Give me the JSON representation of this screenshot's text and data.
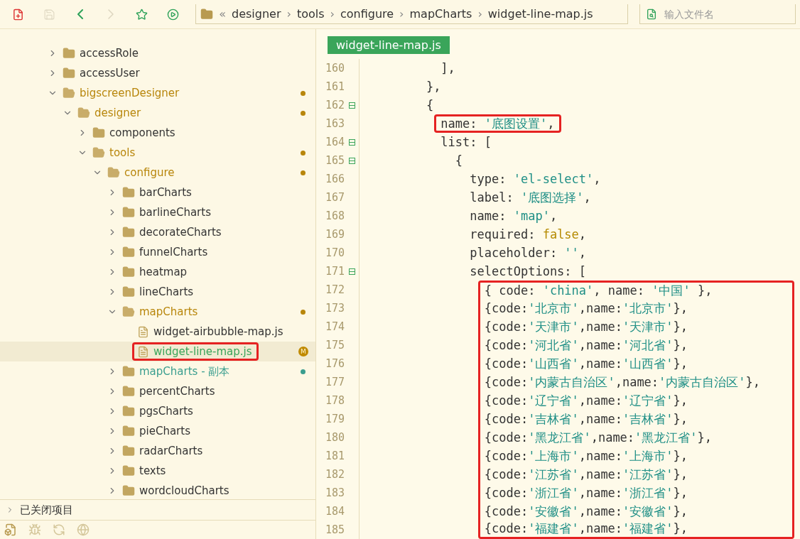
{
  "toolbar": {
    "buttons": [
      {
        "kind": "new-file",
        "disabled": false
      },
      {
        "kind": "save",
        "disabled": true
      },
      {
        "kind": "back",
        "disabled": false
      },
      {
        "kind": "forward",
        "disabled": true
      },
      {
        "kind": "favorite",
        "disabled": false
      },
      {
        "kind": "run",
        "disabled": false
      }
    ],
    "breadcrumb": {
      "overflow": "«",
      "separator": "›",
      "segments": [
        "designer",
        "tools",
        "configure",
        "mapCharts",
        "widget-line-map.js"
      ]
    },
    "search": {
      "placeholder": "输入文件名"
    }
  },
  "tree": [
    {
      "name": "accessRole",
      "kind": "folder",
      "expanded": false
    },
    {
      "name": "accessUser",
      "kind": "folder",
      "expanded": false
    },
    {
      "name": "bigscreenDesigner",
      "kind": "folder",
      "expanded": true,
      "color": "#b8860b",
      "children": [
        {
          "name": "designer",
          "kind": "folder",
          "expanded": true,
          "color": "#b8860b",
          "children": [
            {
              "name": "components",
              "kind": "folder",
              "expanded": false
            },
            {
              "name": "tools",
              "kind": "folder",
              "expanded": true,
              "color": "#b8860b",
              "children": [
                {
                  "name": "configure",
                  "kind": "folder",
                  "expanded": true,
                  "color": "#b8860b",
                  "children": [
                    {
                      "name": "barCharts",
                      "kind": "folder",
                      "expanded": false
                    },
                    {
                      "name": "barlineCharts",
                      "kind": "folder",
                      "expanded": false
                    },
                    {
                      "name": "decorateCharts",
                      "kind": "folder",
                      "expanded": false
                    },
                    {
                      "name": "funnelCharts",
                      "kind": "folder",
                      "expanded": false
                    },
                    {
                      "name": "heatmap",
                      "kind": "folder",
                      "expanded": false
                    },
                    {
                      "name": "lineCharts",
                      "kind": "folder",
                      "expanded": false
                    },
                    {
                      "name": "mapCharts",
                      "kind": "folder",
                      "expanded": true,
                      "color": "#b8860b",
                      "children": [
                        {
                          "name": "widget-airbubble-map.js",
                          "kind": "file",
                          "selected": false
                        },
                        {
                          "name": "widget-line-map.js",
                          "kind": "file",
                          "selected": true,
                          "boxed": true,
                          "badge": "M"
                        }
                      ]
                    },
                    {
                      "name": "mapCharts - 副本",
                      "kind": "folder",
                      "expanded": false,
                      "color": "#3a9e8f"
                    },
                    {
                      "name": "percentCharts",
                      "kind": "folder",
                      "expanded": false
                    },
                    {
                      "name": "pgsCharts",
                      "kind": "folder",
                      "expanded": false
                    },
                    {
                      "name": "pieCharts",
                      "kind": "folder",
                      "expanded": false
                    },
                    {
                      "name": "radarCharts",
                      "kind": "folder",
                      "expanded": false
                    },
                    {
                      "name": "texts",
                      "kind": "folder",
                      "expanded": false
                    },
                    {
                      "name": "wordcloudCharts",
                      "kind": "folder",
                      "expanded": false
                    }
                  ]
                }
              ]
            }
          ]
        }
      ]
    }
  ],
  "closed_projects": {
    "label": "已关闭项目",
    "expanded": false
  },
  "bottom_tabs": [
    {
      "kind": "files",
      "selected": true
    },
    {
      "kind": "debug",
      "selected": false
    },
    {
      "kind": "git",
      "selected": false
    },
    {
      "kind": "web",
      "selected": false
    }
  ],
  "editor": {
    "tab": "widget-line-map.js",
    "lines": [
      {
        "number": "160",
        "tokens": [
          {
            "kind": "plain",
            "text": "          ],"
          }
        ]
      },
      {
        "number": "161",
        "tokens": [
          {
            "kind": "plain",
            "text": "        },"
          }
        ]
      },
      {
        "number": "162",
        "foldable": true,
        "tokens": [
          {
            "kind": "plain",
            "text": "        {"
          }
        ]
      },
      {
        "number": "163",
        "boxed": true,
        "tokens": [
          {
            "kind": "plain",
            "text": "          name: "
          },
          {
            "kind": "string",
            "text": "'底图设置'"
          },
          {
            "kind": "plain",
            "text": ","
          }
        ]
      },
      {
        "number": "164",
        "foldable": true,
        "tokens": [
          {
            "kind": "plain",
            "text": "          list: ["
          }
        ]
      },
      {
        "number": "165",
        "foldable": true,
        "tokens": [
          {
            "kind": "plain",
            "text": "            {"
          }
        ]
      },
      {
        "number": "166",
        "tokens": [
          {
            "kind": "plain",
            "text": "              type: "
          },
          {
            "kind": "string",
            "text": "'el-select'"
          },
          {
            "kind": "plain",
            "text": ","
          }
        ]
      },
      {
        "number": "167",
        "tokens": [
          {
            "kind": "plain",
            "text": "              label: "
          },
          {
            "kind": "string",
            "text": "'底图选择'"
          },
          {
            "kind": "plain",
            "text": ","
          }
        ]
      },
      {
        "number": "168",
        "tokens": [
          {
            "kind": "plain",
            "text": "              name: "
          },
          {
            "kind": "string",
            "text": "'map'"
          },
          {
            "kind": "plain",
            "text": ","
          }
        ]
      },
      {
        "number": "169",
        "tokens": [
          {
            "kind": "plain",
            "text": "              required: "
          },
          {
            "kind": "keyword",
            "text": "false"
          },
          {
            "kind": "plain",
            "text": ","
          }
        ]
      },
      {
        "number": "170",
        "tokens": [
          {
            "kind": "plain",
            "text": "              placeholder: "
          },
          {
            "kind": "string",
            "text": "''"
          },
          {
            "kind": "plain",
            "text": ","
          }
        ]
      },
      {
        "number": "171",
        "foldable": true,
        "tokens": [
          {
            "kind": "plain",
            "text": "              selectOptions: ["
          }
        ]
      },
      {
        "number": "172",
        "boxed": true,
        "tokens": [
          {
            "kind": "plain",
            "text": "                { code: "
          },
          {
            "kind": "string",
            "text": "'china'"
          },
          {
            "kind": "plain",
            "text": ", name: "
          },
          {
            "kind": "string",
            "text": "'中国'"
          },
          {
            "kind": "plain",
            "text": " },"
          }
        ]
      },
      {
        "number": "173",
        "boxed": true,
        "tokens": [
          {
            "kind": "plain",
            "text": "                {code:"
          },
          {
            "kind": "string",
            "text": "'北京市'"
          },
          {
            "kind": "plain",
            "text": ",name:"
          },
          {
            "kind": "string",
            "text": "'北京市'"
          },
          {
            "kind": "plain",
            "text": "},"
          }
        ]
      },
      {
        "number": "174",
        "boxed": true,
        "tokens": [
          {
            "kind": "plain",
            "text": "                {code:"
          },
          {
            "kind": "string",
            "text": "'天津市'"
          },
          {
            "kind": "plain",
            "text": ",name:"
          },
          {
            "kind": "string",
            "text": "'天津市'"
          },
          {
            "kind": "plain",
            "text": "},"
          }
        ]
      },
      {
        "number": "175",
        "boxed": true,
        "tokens": [
          {
            "kind": "plain",
            "text": "                {code:"
          },
          {
            "kind": "string",
            "text": "'河北省'"
          },
          {
            "kind": "plain",
            "text": ",name:"
          },
          {
            "kind": "string",
            "text": "'河北省'"
          },
          {
            "kind": "plain",
            "text": "},"
          }
        ]
      },
      {
        "number": "176",
        "boxed": true,
        "tokens": [
          {
            "kind": "plain",
            "text": "                {code:"
          },
          {
            "kind": "string",
            "text": "'山西省'"
          },
          {
            "kind": "plain",
            "text": ",name:"
          },
          {
            "kind": "string",
            "text": "'山西省'"
          },
          {
            "kind": "plain",
            "text": "},"
          }
        ]
      },
      {
        "number": "177",
        "boxed": true,
        "tokens": [
          {
            "kind": "plain",
            "text": "                {code:"
          },
          {
            "kind": "string",
            "text": "'内蒙古自治区'"
          },
          {
            "kind": "plain",
            "text": ",name:"
          },
          {
            "kind": "string",
            "text": "'内蒙古自治区'"
          },
          {
            "kind": "plain",
            "text": "},"
          }
        ]
      },
      {
        "number": "178",
        "boxed": true,
        "tokens": [
          {
            "kind": "plain",
            "text": "                {code:"
          },
          {
            "kind": "string",
            "text": "'辽宁省'"
          },
          {
            "kind": "plain",
            "text": ",name:"
          },
          {
            "kind": "string",
            "text": "'辽宁省'"
          },
          {
            "kind": "plain",
            "text": "},"
          }
        ]
      },
      {
        "number": "179",
        "boxed": true,
        "tokens": [
          {
            "kind": "plain",
            "text": "                {code:"
          },
          {
            "kind": "string",
            "text": "'吉林省'"
          },
          {
            "kind": "plain",
            "text": ",name:"
          },
          {
            "kind": "string",
            "text": "'吉林省'"
          },
          {
            "kind": "plain",
            "text": "},"
          }
        ]
      },
      {
        "number": "180",
        "boxed": true,
        "tokens": [
          {
            "kind": "plain",
            "text": "                {code:"
          },
          {
            "kind": "string",
            "text": "'黑龙江省'"
          },
          {
            "kind": "plain",
            "text": ",name:"
          },
          {
            "kind": "string",
            "text": "'黑龙江省'"
          },
          {
            "kind": "plain",
            "text": "},"
          }
        ]
      },
      {
        "number": "181",
        "boxed": true,
        "tokens": [
          {
            "kind": "plain",
            "text": "                {code:"
          },
          {
            "kind": "string",
            "text": "'上海市'"
          },
          {
            "kind": "plain",
            "text": ",name:"
          },
          {
            "kind": "string",
            "text": "'上海市'"
          },
          {
            "kind": "plain",
            "text": "},"
          }
        ]
      },
      {
        "number": "182",
        "boxed": true,
        "tokens": [
          {
            "kind": "plain",
            "text": "                {code:"
          },
          {
            "kind": "string",
            "text": "'江苏省'"
          },
          {
            "kind": "plain",
            "text": ",name:"
          },
          {
            "kind": "string",
            "text": "'江苏省'"
          },
          {
            "kind": "plain",
            "text": "},"
          }
        ]
      },
      {
        "number": "183",
        "boxed": true,
        "tokens": [
          {
            "kind": "plain",
            "text": "                {code:"
          },
          {
            "kind": "string",
            "text": "'浙江省'"
          },
          {
            "kind": "plain",
            "text": ",name:"
          },
          {
            "kind": "string",
            "text": "'浙江省'"
          },
          {
            "kind": "plain",
            "text": "},"
          }
        ]
      },
      {
        "number": "184",
        "boxed": true,
        "tokens": [
          {
            "kind": "plain",
            "text": "                {code:"
          },
          {
            "kind": "string",
            "text": "'安徽省'"
          },
          {
            "kind": "plain",
            "text": ",name:"
          },
          {
            "kind": "string",
            "text": "'安徽省'"
          },
          {
            "kind": "plain",
            "text": "},"
          }
        ]
      },
      {
        "number": "185",
        "boxed": true,
        "tokens": [
          {
            "kind": "plain",
            "text": "                {code:"
          },
          {
            "kind": "string",
            "text": "'福建省'"
          },
          {
            "kind": "plain",
            "text": ",name:"
          },
          {
            "kind": "string",
            "text": "'福建省'"
          },
          {
            "kind": "plain",
            "text": "},"
          }
        ]
      }
    ]
  }
}
